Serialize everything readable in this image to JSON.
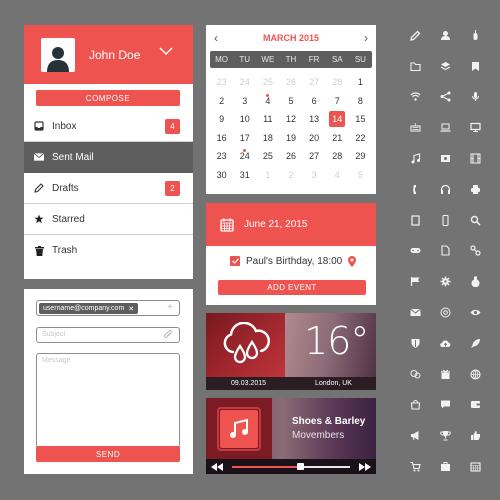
{
  "mail": {
    "user_name": "John Doe",
    "compose_label": "COMPOSE",
    "folders": [
      {
        "label": "Inbox",
        "icon": "inbox-icon",
        "badge": "4"
      },
      {
        "label": "Sent Mail",
        "icon": "envelope-icon",
        "badge": null,
        "active": true
      },
      {
        "label": "Drafts",
        "icon": "pencil-icon",
        "badge": "2"
      },
      {
        "label": "Starred",
        "icon": "star-icon",
        "badge": null
      },
      {
        "label": "Trash",
        "icon": "trash-icon",
        "badge": null
      }
    ]
  },
  "compose": {
    "to_tag": "username@company.com",
    "add_recipient": "+",
    "subject_placeholder": "Subject",
    "message_placeholder": "Message",
    "send_label": "SEND"
  },
  "calendar": {
    "month_label": "MARCH 2015",
    "prev": "‹",
    "next": "›",
    "weekdays": [
      "MO",
      "TU",
      "WE",
      "TH",
      "FR",
      "SA",
      "SU"
    ],
    "days": [
      {
        "d": "23",
        "muted": true
      },
      {
        "d": "24",
        "muted": true
      },
      {
        "d": "25",
        "muted": true
      },
      {
        "d": "26",
        "muted": true
      },
      {
        "d": "27",
        "muted": true
      },
      {
        "d": "28",
        "muted": true
      },
      {
        "d": "1"
      },
      {
        "d": "2"
      },
      {
        "d": "3"
      },
      {
        "d": "4",
        "event": true
      },
      {
        "d": "5"
      },
      {
        "d": "6"
      },
      {
        "d": "7"
      },
      {
        "d": "8"
      },
      {
        "d": "9"
      },
      {
        "d": "10"
      },
      {
        "d": "11"
      },
      {
        "d": "12"
      },
      {
        "d": "13"
      },
      {
        "d": "14",
        "selected": true
      },
      {
        "d": "15"
      },
      {
        "d": "16"
      },
      {
        "d": "17"
      },
      {
        "d": "18"
      },
      {
        "d": "19"
      },
      {
        "d": "20"
      },
      {
        "d": "21"
      },
      {
        "d": "22"
      },
      {
        "d": "23"
      },
      {
        "d": "24",
        "event": true
      },
      {
        "d": "25"
      },
      {
        "d": "26"
      },
      {
        "d": "27"
      },
      {
        "d": "28"
      },
      {
        "d": "29"
      },
      {
        "d": "30"
      },
      {
        "d": "31"
      },
      {
        "d": "1",
        "muted": true
      },
      {
        "d": "2",
        "muted": true
      },
      {
        "d": "3",
        "muted": true
      },
      {
        "d": "4",
        "muted": true
      },
      {
        "d": "5",
        "muted": true
      }
    ]
  },
  "event": {
    "date": "June 21, 2015",
    "item": "Paul's Birthday, 18:00",
    "checked": true,
    "add_label": "ADD EVENT"
  },
  "weather": {
    "icon": "cloud-rain-icon",
    "temperature": "16°",
    "date": "09.03.2015",
    "location": "London, UK"
  },
  "music": {
    "title": "Shoes & Barley",
    "artist": "Movembers",
    "progress": 0.58
  },
  "colors": {
    "accent": "#ef5350",
    "dark": "#5e5e5e",
    "background": "#737373"
  },
  "icon_grid": [
    "pencil-icon",
    "user-icon",
    "mouse-icon",
    "folder-icon",
    "layers-icon",
    "bookmark-icon",
    "wifi-icon",
    "share-icon",
    "microphone-icon",
    "keyboard-icon",
    "laptop-icon",
    "monitor-icon",
    "music-note-icon",
    "image-icon",
    "film-icon",
    "phone-icon",
    "headphones-icon",
    "printer-icon",
    "tablet-icon",
    "smartphone-icon",
    "search-icon",
    "gamepad-icon",
    "document-icon",
    "link-icon",
    "flag-icon",
    "gear-icon",
    "flask-icon",
    "mail-icon",
    "at-icon",
    "eye-icon",
    "shield-icon",
    "cloud-upload-icon",
    "rocket-icon",
    "chat-icon",
    "gift-icon",
    "globe-icon",
    "shopping-bag-icon",
    "comment-icon",
    "wallet-icon",
    "megaphone-icon",
    "trophy-icon",
    "thumbs-up-icon",
    "cart-icon",
    "briefcase-icon",
    "calendar-icon"
  ]
}
